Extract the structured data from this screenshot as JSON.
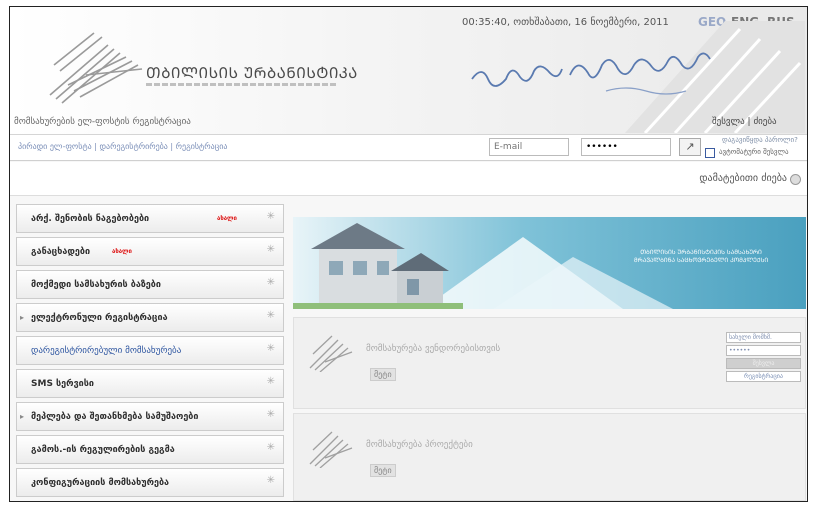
{
  "header": {
    "logo_text": "ᲗᲑᲘᲚᲘᲡᲘᲡ ᲣᲠᲑᲐᲜᲘᲡᲢᲘᲙᲐ",
    "datetime": "00:35:40, ოთხშაბათი, 16 ნოემბერი, 2011",
    "languages": {
      "geo": "GEO",
      "eng": "ENG",
      "rus": "RUS"
    },
    "section_link": "მომსახურების ელ-ფოსტის რეგისტრაცია",
    "user_links": "შესვლა | ძიება"
  },
  "login": {
    "breadcrumb": "პირადი ელ-ფოსტა | დარეგისტრირება | რეგისტრაცია",
    "email_placeholder": "E-mail",
    "password_value": "••••••",
    "go_icon": "arrow-icon",
    "forgot": "დაგავიწყდა პაროლი?",
    "remember": "ავტომატური შესვლა"
  },
  "search": {
    "label": "დამატებითი ძიება"
  },
  "sidebar": {
    "items": [
      {
        "label": "არქ. შენობის ნაგებობები",
        "badge": "ახალი"
      },
      {
        "label": "განაცხადები",
        "badge": "ახალი"
      },
      {
        "label": "მოქმედი სამსახურის ბაზები",
        "badge": ""
      },
      {
        "label": "ელექტრონული რეგისტრაცია",
        "badge": ""
      },
      {
        "label": "დარეგისტრირებული მომსახურება",
        "badge": ""
      },
      {
        "label": "SMS სერვისი",
        "badge": ""
      },
      {
        "label": "მეპლება და შეთანხმება სამუშაოები",
        "badge": ""
      },
      {
        "label": "გამოს.-ის რეგულირების გეგმა",
        "badge": ""
      },
      {
        "label": "კონფიგურაციის მომსახურება",
        "badge": ""
      }
    ]
  },
  "banner": {
    "text": "ᲗᲑᲘᲚᲘᲡᲘᲡ ᲣᲠᲑᲐᲜᲘᲡᲢᲘᲙᲘᲡ ᲡᲐᲛᲡᲐᲮᲣᲠᲘ ᲛᲠᲐᲕᲐᲚᲑᲘᲜᲐ ᲡᲐᲪᲮᲝᲕᲠᲔᲑᲔᲚᲘ ᲙᲝᲛᲞᲚᲔᲥᲡᲘ"
  },
  "panels": [
    {
      "title": "მომსახურება ვენდორებისთვის",
      "more": "მეტი"
    },
    {
      "title": "მომსახურება პროექტები",
      "more": "მეტი"
    }
  ],
  "mini_login": {
    "user": "სახელი მომხმ.",
    "pass": "••••••",
    "button": "შესვლა",
    "register": "რეგისტრაცია"
  }
}
